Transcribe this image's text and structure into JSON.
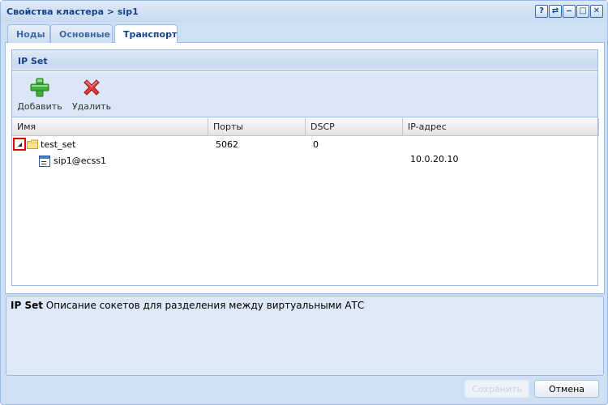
{
  "window": {
    "title": "Свойства кластера > sip1",
    "tools": [
      "?",
      "⇄",
      "‒",
      "□",
      "✕"
    ]
  },
  "tabs": [
    {
      "label": "Ноды",
      "active": false
    },
    {
      "label": "Основные",
      "active": false
    },
    {
      "label": "Транспорт",
      "active": true
    }
  ],
  "panel": {
    "title": "IP Set",
    "toolbar": {
      "add_label": "Добавить",
      "delete_label": "Удалить",
      "add_icon": "plus-icon",
      "delete_icon": "delete-x-icon"
    },
    "columns": [
      "Имя",
      "Порты",
      "DSCP",
      "IP-адрес"
    ],
    "rows": [
      {
        "name": "test_set",
        "ports": "5062",
        "dscp": "0",
        "ip": "",
        "icon": "folder-icon",
        "expanded": true
      },
      {
        "name": "sip1@ecss1",
        "ports": "",
        "dscp": "",
        "ip": "10.0.20.10",
        "icon": "node-icon"
      }
    ]
  },
  "description": {
    "title": "IP Set",
    "text": "Описание сокетов для разделения между виртуальными АТС"
  },
  "buttons": {
    "save_label": "Сохранить",
    "cancel_label": "Отмена"
  },
  "colors": {
    "title": "#15428b",
    "border": "#99bbe8",
    "frame": "#cee0f4",
    "highlight": "#e00000"
  }
}
